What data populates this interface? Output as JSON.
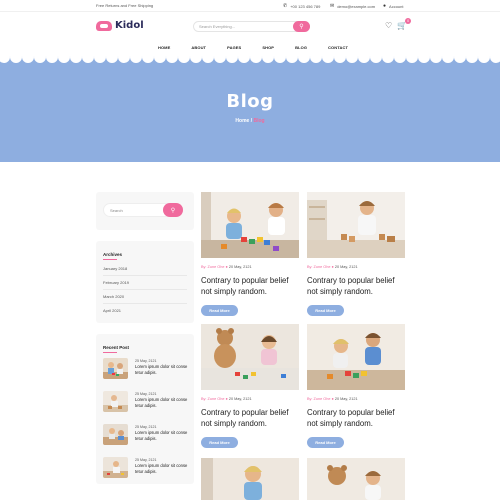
{
  "topbar": {
    "shipping": "Free Returns and Free Shipping",
    "phone": "+00 123 456 789",
    "email": "demo@example.com",
    "account": "Account"
  },
  "header": {
    "logo_text": "Kidol",
    "search_placeholder": "Search Everything...",
    "cart_count": "0"
  },
  "nav": [
    "HOME",
    "ABOUT",
    "PAGES",
    "SHOP",
    "BLOG",
    "CONTACT"
  ],
  "hero": {
    "title": "Blog",
    "breadcrumb_home": "Home",
    "breadcrumb_sep": " / ",
    "breadcrumb_current": "Blog"
  },
  "sidebar": {
    "search_placeholder": "Search",
    "archives_title": "Archives",
    "archives": [
      "January 2018",
      "February 2019",
      "March 2020",
      "April 2021"
    ],
    "recent_title": "Recent Post",
    "recent_posts": [
      {
        "date": "25 May, 2121",
        "text": "Lorem ipsum dolor sit conse tetur adipis."
      },
      {
        "date": "25 May, 2121",
        "text": "Lorem ipsum dolor sit conse tetur adipis."
      },
      {
        "date": "25 May, 2121",
        "text": "Lorem ipsum dolor sit conse tetur adipis."
      },
      {
        "date": "25 May, 2121",
        "text": "Lorem ipsum dolor sit conse tetur adipis."
      }
    ]
  },
  "posts": [
    {
      "by": "By: Zune Ohe",
      "date": "20 May, 2121",
      "title": "Contrary to popular belief not simply random.",
      "button": "Read More"
    },
    {
      "by": "By: Zune Ohe",
      "date": "20 May, 2121",
      "title": "Contrary to popular belief not simply random.",
      "button": "Read More"
    },
    {
      "by": "By: Zune Ohe",
      "date": "20 May, 2121",
      "title": "Contrary to popular belief not simply random.",
      "button": "Read More"
    },
    {
      "by": "By: Zune Ohe",
      "date": "20 May, 2121",
      "title": "Contrary to popular belief not simply random.",
      "button": "Read More"
    }
  ],
  "colors": {
    "accent_pink": "#f06a9d",
    "hero_blue": "#8eaee0",
    "button_blue": "#8eaee0"
  }
}
